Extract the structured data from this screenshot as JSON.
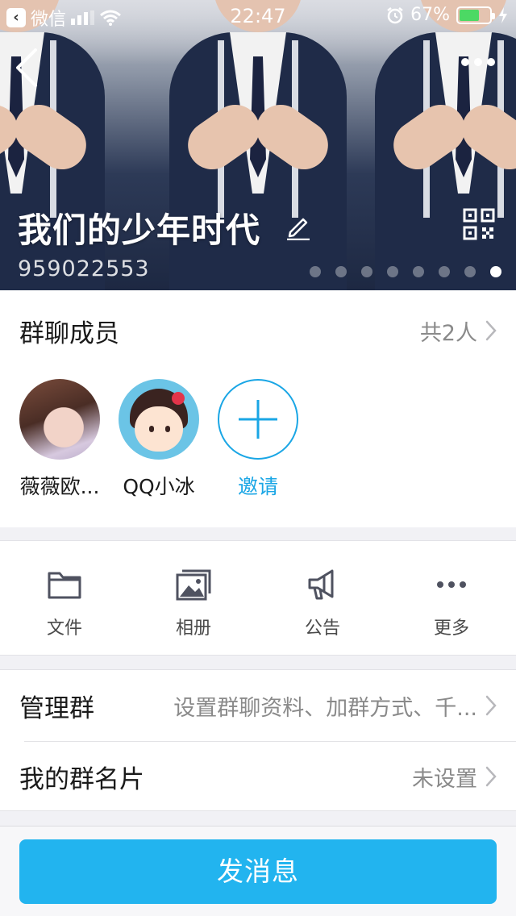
{
  "status_bar": {
    "app_name": "微信",
    "time": "22:47",
    "battery_percent": "67%",
    "battery_level": 0.67
  },
  "header": {
    "group_name": "我们的少年时代",
    "group_id": "959022553",
    "photo_pages": 8,
    "active_page": 8
  },
  "members": {
    "title": "群聊成员",
    "count_label": "共2人",
    "list": [
      {
        "name": "薇薇欧..."
      },
      {
        "name": "QQ小冰"
      }
    ],
    "invite_label": "邀请"
  },
  "tools": [
    {
      "icon": "folder-icon",
      "label": "文件"
    },
    {
      "icon": "photo-album-icon",
      "label": "相册"
    },
    {
      "icon": "megaphone-icon",
      "label": "公告"
    },
    {
      "icon": "more-dots-icon",
      "label": "更多"
    }
  ],
  "settings": {
    "manage_title": "管理群",
    "manage_value": "设置群聊资料、加群方式、千...",
    "card_title": "我的群名片",
    "card_value": "未设置"
  },
  "actions": {
    "send_message": "发消息"
  },
  "colors": {
    "accent": "#22b4ef",
    "link": "#1aa6e5",
    "battery": "#4cd964"
  }
}
